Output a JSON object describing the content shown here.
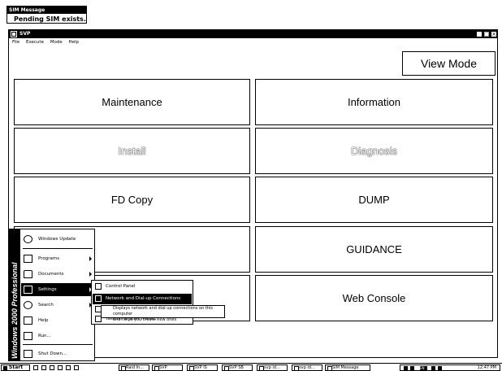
{
  "sim_message": {
    "title": "SIM Message",
    "text": "Pending SIM exists."
  },
  "window": {
    "title": "SVP",
    "controls": [
      "_",
      "□",
      "×"
    ]
  },
  "menubar": [
    "File",
    "Execute",
    "Mode",
    "Help"
  ],
  "view_mode_label": "View Mode",
  "tiles": [
    {
      "label": "Maintenance",
      "enabled": true
    },
    {
      "label": "Information",
      "enabled": true
    },
    {
      "label": "Install",
      "enabled": false
    },
    {
      "label": "Diagnosis",
      "enabled": false
    },
    {
      "label": "FD Copy",
      "enabled": true
    },
    {
      "label": "DUMP",
      "enabled": true
    },
    {
      "label": "GUIDANCE",
      "enabled": true
    },
    {
      "label": "Web Console",
      "enabled": true
    }
  ],
  "start_menu": {
    "band_text": "Windows 2000 Professional",
    "items": [
      {
        "label": "Windows Update",
        "icon": "globe-icon",
        "submenu": false
      },
      {
        "label": "Programs",
        "icon": "programs-icon",
        "submenu": true
      },
      {
        "label": "Documents",
        "icon": "folder-icon",
        "submenu": true
      },
      {
        "label": "Settings",
        "icon": "settings-icon",
        "submenu": true,
        "active": true
      },
      {
        "label": "Search",
        "icon": "search-icon",
        "submenu": true
      },
      {
        "label": "Help",
        "icon": "help-icon",
        "submenu": false
      },
      {
        "label": "Run...",
        "icon": "run-icon",
        "submenu": false
      },
      {
        "label": "Shut Down...",
        "icon": "shutdown-icon",
        "submenu": false
      }
    ]
  },
  "settings_submenu": [
    {
      "label": "Control Panel",
      "icon": "control-panel-icon"
    },
    {
      "label": "Network and Dial-up Connections",
      "icon": "network-icon",
      "active": true
    },
    {
      "label": "Pr",
      "icon": "printers-icon"
    },
    {
      "label": "Taskbar & Start Menu...",
      "icon": "taskbar-icon"
    }
  ],
  "tooltip": {
    "line1": "Displays network and dial-up connections on this computer",
    "line2": "and helps you create new ones"
  },
  "taskbar": {
    "start_label": "Start",
    "buttons": [
      "Raid In...",
      "SVP",
      "SVP IS",
      "SVP SB",
      "svp id...",
      "svp id...",
      "SIM Message"
    ],
    "tray_label": "EN",
    "clock": "12:47 PM"
  }
}
